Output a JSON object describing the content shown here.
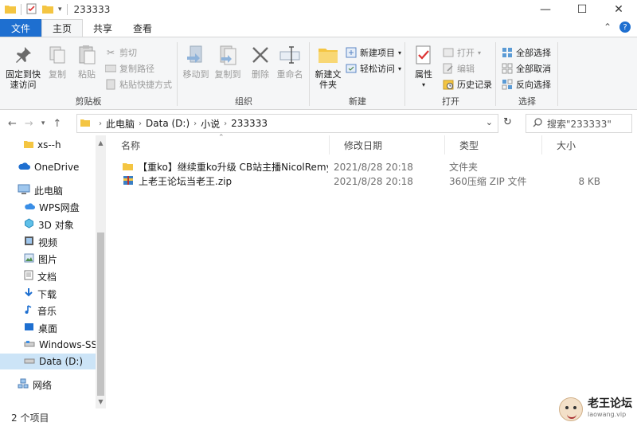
{
  "window": {
    "title": "233333",
    "minimize": "—",
    "maximize": "☐",
    "close": "✕"
  },
  "tabs": {
    "file": "文件",
    "home": "主页",
    "share": "共享",
    "view": "查看",
    "collapse": "⌃",
    "help": "?"
  },
  "ribbon": {
    "clipboard": {
      "label": "剪贴板",
      "pin": "固定到快速访问",
      "copy": "复制",
      "paste": "粘贴",
      "cut": "剪切",
      "copy_path": "复制路径",
      "paste_shortcut": "粘贴快捷方式"
    },
    "organize": {
      "label": "组织",
      "move_to": "移动到",
      "copy_to": "复制到",
      "delete": "删除",
      "rename": "重命名"
    },
    "new": {
      "label": "新建",
      "new_folder": "新建文件夹",
      "new_item": "新建项目",
      "easy_access": "轻松访问"
    },
    "open": {
      "label": "打开",
      "properties": "属性",
      "open": "打开",
      "edit": "编辑",
      "history": "历史记录"
    },
    "select": {
      "label": "选择",
      "select_all": "全部选择",
      "select_none": "全部取消",
      "invert": "反向选择"
    }
  },
  "address": {
    "crumbs": [
      "此电脑",
      "Data (D:)",
      "小说",
      "233333"
    ],
    "search_placeholder": "搜索\"233333\""
  },
  "sidebar": {
    "items": [
      {
        "label": "xs--h",
        "icon": "folder-icon"
      },
      {
        "label": "OneDrive",
        "icon": "cloud-icon"
      },
      {
        "label": "此电脑",
        "icon": "computer-icon"
      },
      {
        "label": "WPS网盘",
        "icon": "cloud-icon"
      },
      {
        "label": "3D 对象",
        "icon": "cube-icon"
      },
      {
        "label": "视频",
        "icon": "video-icon"
      },
      {
        "label": "图片",
        "icon": "picture-icon"
      },
      {
        "label": "文档",
        "icon": "document-icon"
      },
      {
        "label": "下载",
        "icon": "download-icon"
      },
      {
        "label": "音乐",
        "icon": "music-icon"
      },
      {
        "label": "桌面",
        "icon": "desktop-icon"
      },
      {
        "label": "Windows-SSD",
        "icon": "drive-icon"
      },
      {
        "label": "Data (D:)",
        "icon": "drive-icon"
      },
      {
        "label": "网络",
        "icon": "network-icon"
      }
    ]
  },
  "columns": {
    "name": "名称",
    "modified": "修改日期",
    "type": "类型",
    "size": "大小"
  },
  "files": [
    {
      "name": "【重ko】继续重ko升级 CB站主播NicolRemy ...",
      "modified": "2021/8/28 20:18",
      "type": "文件夹",
      "size": ""
    },
    {
      "name": "上老王论坛当老王.zip",
      "modified": "2021/8/28 20:18",
      "type": "360压缩 ZIP 文件",
      "size": "8 KB"
    }
  ],
  "status": {
    "count": "2 个项目"
  },
  "watermark": {
    "title": "老王论坛",
    "subtitle": "laowang.vip"
  },
  "colors": {
    "accent": "#1e6fd0",
    "selection": "#cce4f7",
    "folder": "#f4c542"
  }
}
